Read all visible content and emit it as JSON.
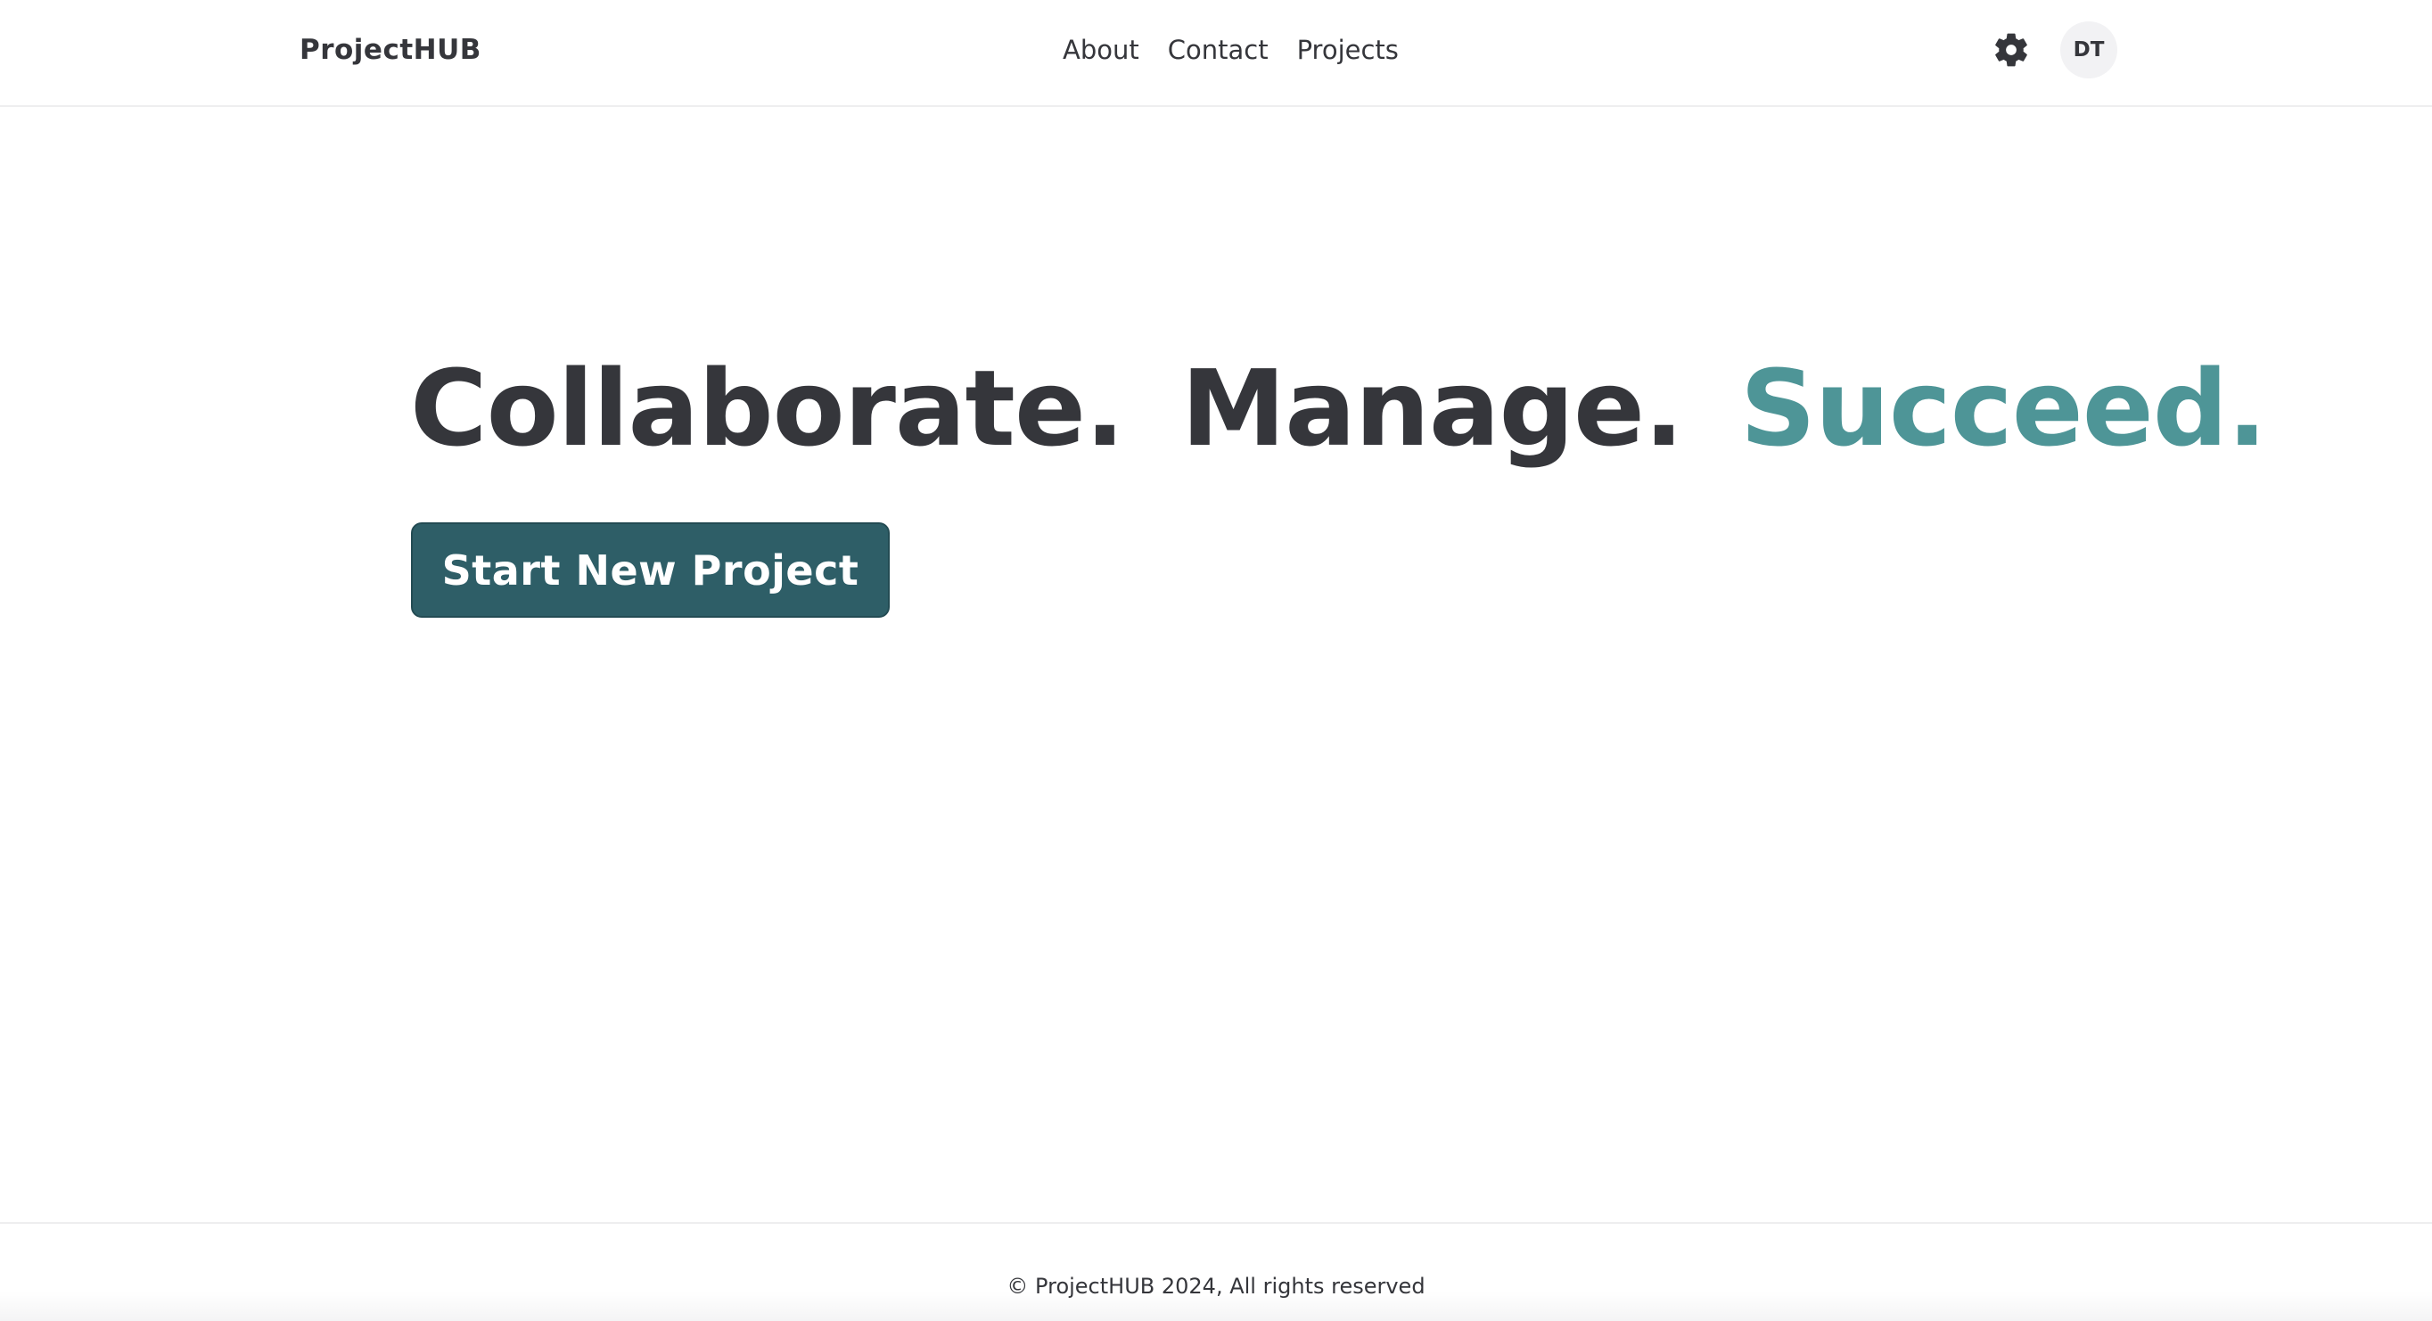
{
  "header": {
    "brand": "ProjectHUB",
    "nav": [
      {
        "label": "About"
      },
      {
        "label": "Contact"
      },
      {
        "label": "Projects"
      }
    ],
    "settings_icon": "gear-icon",
    "avatar_initials": "DT"
  },
  "hero": {
    "words": [
      "Collaborate.",
      "Manage.",
      "Succeed."
    ],
    "cta_label": "Start New Project"
  },
  "footer": {
    "copyright": "© ProjectHUB 2024, All rights reserved"
  },
  "colors": {
    "text_dark": "#35363b",
    "accent": "#4e9597",
    "cta_background": "#2e5e67",
    "avatar_background": "#f2f2f4"
  }
}
